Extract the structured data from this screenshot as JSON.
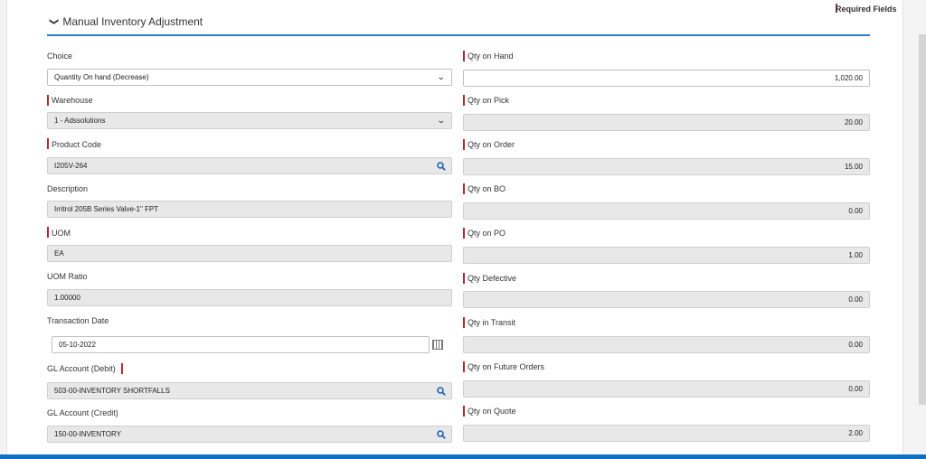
{
  "header": {
    "required_fields": "Required Fields",
    "section_title": "Manual Inventory Adjustment"
  },
  "left": {
    "choice_label": "Choice",
    "choice_value": "Quantity On hand (Decrease)",
    "warehouse_label": "Warehouse",
    "warehouse_value": "1 - Adssolutions",
    "product_code_label": "Product Code",
    "product_code_value": "I205V-264",
    "description_label": "Description",
    "description_value": "Irritrol 205B Series Valve-1\" FPT",
    "uom_label": "UOM",
    "uom_value": "EA",
    "uom_ratio_label": "UOM Ratio",
    "uom_ratio_value": "1.00000",
    "transaction_date_label": "Transaction Date",
    "transaction_date_value": "05-10-2022",
    "gl_debit_label": "GL Account (Debit)",
    "gl_debit_value": "503-00-INVENTORY SHORTFALLS",
    "gl_credit_label": "GL Account (Credit)",
    "gl_credit_value": "150-00-INVENTORY"
  },
  "right": {
    "qty_on_hand_label": "Qty on Hand",
    "qty_on_hand_value": "1,020.00",
    "qty_on_pick_label": "Qty on Pick",
    "qty_on_pick_value": "20.00",
    "qty_on_order_label": "Qty on Order",
    "qty_on_order_value": "15.00",
    "qty_on_bo_label": "Qty on BO",
    "qty_on_bo_value": "0.00",
    "qty_on_po_label": "Qty on PO",
    "qty_on_po_value": "1.00",
    "qty_defective_label": "Qty Defective",
    "qty_defective_value": "0.00",
    "qty_in_transit_label": "Qty in Transit",
    "qty_in_transit_value": "0.00",
    "qty_future_orders_label": "Qty on Future Orders",
    "qty_future_orders_value": "0.00",
    "qty_on_quote_label": "Qty on Quote",
    "qty_on_quote_value": "2.00"
  },
  "icons": {
    "section_toggle": "chevron-down-icon",
    "select_caret": "caret-down-icon",
    "lookup": "search-icon",
    "calendar": "calendar-icon"
  },
  "colors": {
    "accent": "#2b7bd0",
    "required": "#b22a2a",
    "bottom_bar": "#0d6fc3"
  }
}
